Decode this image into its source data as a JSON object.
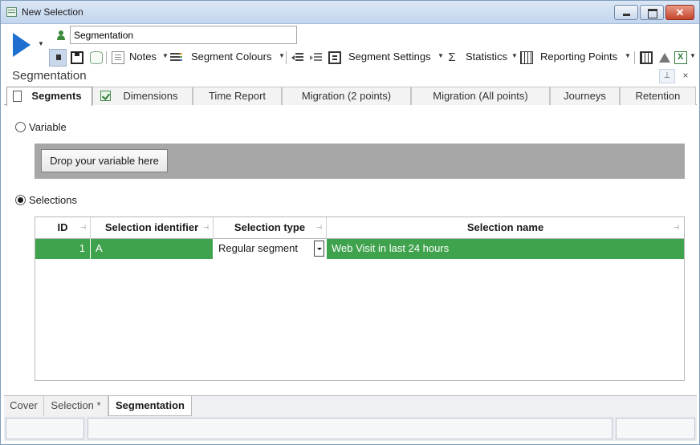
{
  "window": {
    "title": "New Selection"
  },
  "toolbar": {
    "name_value": "Segmentation",
    "notes_label": "Notes",
    "segment_colours_label": "Segment Colours",
    "segment_settings_label": "Segment Settings",
    "statistics_label": "Statistics",
    "reporting_points_label": "Reporting Points"
  },
  "panel": {
    "title": "Segmentation"
  },
  "tabs": [
    {
      "label": "Segments",
      "active": true
    },
    {
      "label": "Dimensions"
    },
    {
      "label": "Time Report"
    },
    {
      "label": "Migration (2 points)"
    },
    {
      "label": "Migration (All points)"
    },
    {
      "label": "Journeys"
    },
    {
      "label": "Retention"
    }
  ],
  "options": {
    "variable_label": "Variable",
    "drop_button_label": "Drop your variable here",
    "selections_label": "Selections",
    "selected": "Selections"
  },
  "grid": {
    "columns": [
      "ID",
      "Selection identifier",
      "Selection type",
      "Selection name"
    ],
    "rows": [
      {
        "id": "1",
        "identifier": "A",
        "type": "Regular segment",
        "name": "Web Visit in last 24 hours"
      }
    ]
  },
  "bottom_tabs": [
    {
      "label": "Cover"
    },
    {
      "label": "Selection *"
    },
    {
      "label": "Segmentation",
      "active": true
    }
  ],
  "colors": {
    "selected_row": "#3fa34d",
    "drop_zone": "#a7a7a7",
    "play_icon": "#1f6fd1"
  }
}
